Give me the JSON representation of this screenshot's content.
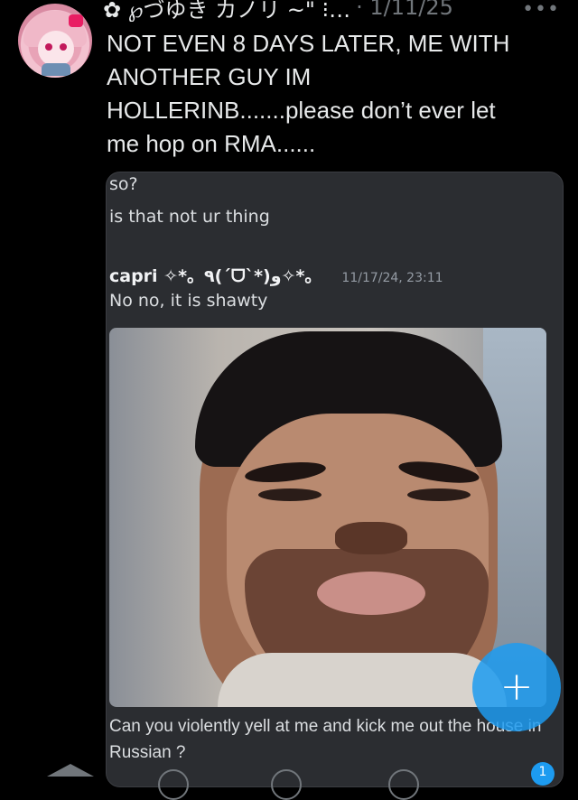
{
  "header": {
    "name": "✿ ℘づゆき カノリ ~\" ⁝…",
    "date": "· 1/11/25",
    "more_icon": "more-horizontal-icon"
  },
  "tweet": {
    "text": "NOT EVEN 8 DAYS LATER, ME WITH\nANOTHER GUY IM\nHOLLERINB.......please don’t ever let\nme hop on RMA......"
  },
  "embedded": {
    "messages": [
      "so?",
      "is that not ur thing"
    ],
    "author": "capri ✧*。٩(ˊᗜˋ*)و✧*。",
    "timestamp": "11/17/24, 23:11",
    "reply": "No no, it is shawty",
    "media_icon": "photo-of-man-icon",
    "caption": "Can you violently yell at me and kick me out the house in Russian ?"
  },
  "fab": {
    "label": "+",
    "icon": "compose-plus-icon"
  },
  "nav": {
    "notification_count": "1"
  },
  "colors": {
    "accent": "#1d9bf0",
    "background": "#000000",
    "card": "#2b2d31"
  }
}
